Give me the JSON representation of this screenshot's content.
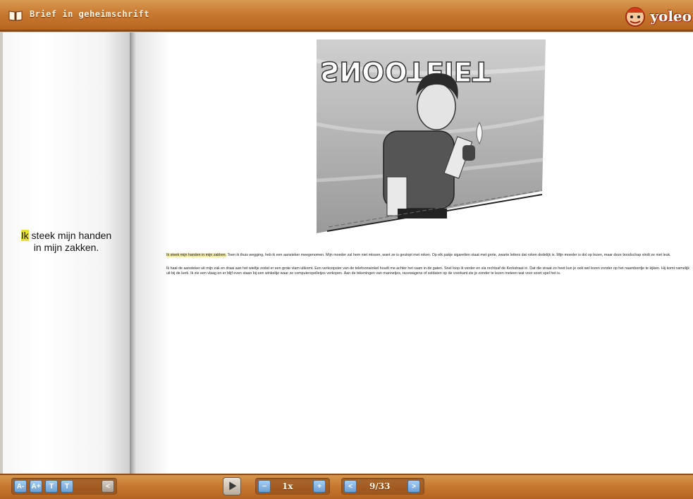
{
  "header": {
    "title": "Brief in geheimschrift",
    "brand": "yoleo"
  },
  "left_page": {
    "highlight_word": "Ik",
    "sentence_rest": " steek mijn handen in mijn zakken."
  },
  "right_page": {
    "illustration_sign": "SNOOTEIET",
    "paragraph1_highlight": "Ik steek mijn handen in mijn zakken.",
    "paragraph1_rest": " Toen ik thuis wegging, heb ik een aansteker meegenomen. Mijn moeder zal hem niet missen, want ze is gestopt met roken. Op elk pakje sigaretten staat met grote, zwarte letters dat roken dodelijk is. Mijn moeder is dol op lezen, maar deze boodschap vindt ze niet leuk.",
    "paragraph2": "Ik haal de aansteker uit mijn zak en draai aan het wieltje zodat er een grote vlam uitkomt. Een verkoopster van de telefoonwinkel houdt me achter het raam in de gaten. Snel loop ik verder en sla rechtsaf de Kerkstraat in. Dat die straat zo heet kun je ook wel lezen zonder op het naambordje te kijken. Hij komt namelijk uit bij de kerk. Ik zie een vlaag en er blijf even staan bij een winkeltje waar ze computerspelletjes verkopen. Aan de tekeningen van mannetjes, racewagens of soldaten op de voorkant zie je zonder te lezen meteen wat voor soort spel het is."
  },
  "toolbar": {
    "text_tools": [
      "A-",
      "A+",
      "T",
      "T"
    ],
    "back_label": "<",
    "play_label": "▶",
    "speed_minus": "−",
    "speed_value": "1x",
    "speed_plus": "+",
    "page_prev": "<",
    "page_indicator": "9/33",
    "page_next": ">"
  }
}
